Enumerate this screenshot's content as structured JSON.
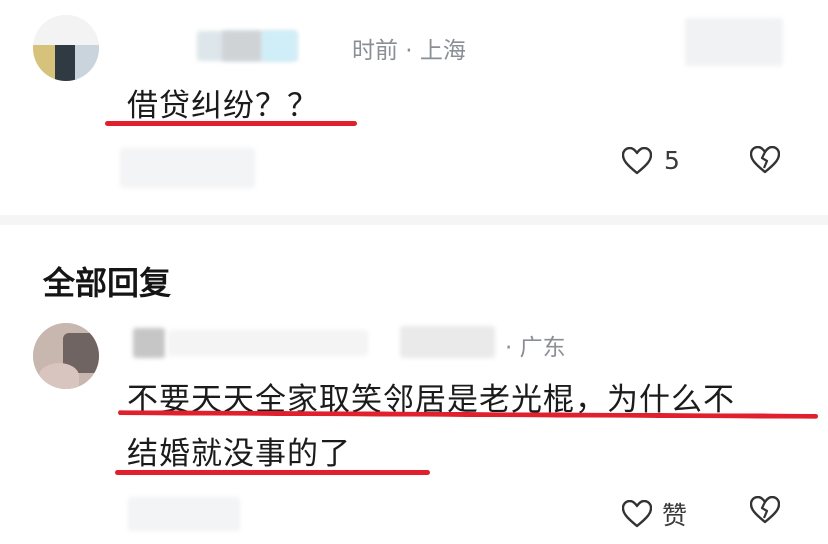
{
  "top_comment": {
    "time_location": "时前 · 上海",
    "text": "借贷纠纷？？",
    "like_count": "5",
    "icons": {
      "like": "heart-outline-icon",
      "dislike": "broken-heart-icon"
    }
  },
  "replies_section": {
    "title": "全部回复"
  },
  "reply": {
    "location": "· 广东",
    "text_line1": "不要天天全家取笑邻居是老光棍，为什么不",
    "text_line2": "结婚就没事的了",
    "like_label": "赞",
    "icons": {
      "like": "heart-outline-icon",
      "dislike": "broken-heart-icon"
    }
  },
  "colors": {
    "underline": "#e0202c",
    "meta_text": "#8a8f96",
    "divider": "#f5f5f5"
  }
}
